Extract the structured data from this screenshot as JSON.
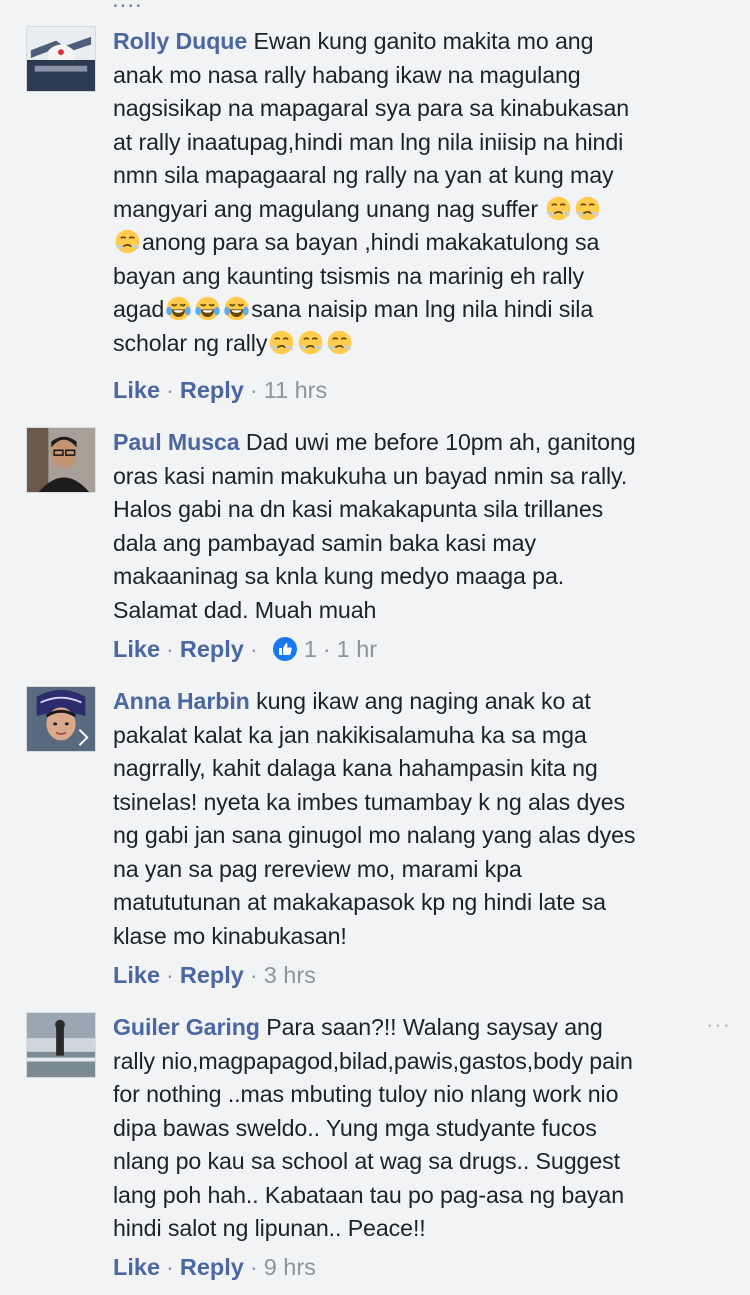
{
  "top_fragment": "....",
  "comments": [
    {
      "author": "Rolly Duque",
      "text_segments": [
        "Ewan kung ganito makita mo ang\nanak mo nasa rally habang ikaw na magulang\nnagsisikap na mapagaral sya para sa kinabukasan\nat rally inaatupag,hindi man lng nila iniisip na hindi\nnmn sila mapagaaral ng rally na yan at kung may\nmangyari ang magulang unang nag suffer ",
        "anong para sa bayan ,hindi makakatulong sa\nbayan ang kaunting tsismis na marinig eh rally\nagad",
        "sana naisip man lng nila hindi sila\nscholar ng rally"
      ],
      "emojis": [
        "steam-face",
        "steam-face",
        "steam-face",
        "tears-of-joy",
        "tears-of-joy",
        "tears-of-joy",
        "steam-face",
        "steam-face",
        "steam-face"
      ],
      "like_label": "Like",
      "reply_label": "Reply",
      "separator": "·",
      "time": "11 hrs"
    },
    {
      "author": "Paul Musca",
      "text": "Dad uwi me before 10pm ah, ganitong\noras kasi namin makukuha un bayad nmin sa rally.\nHalos gabi na dn kasi makakapunta sila trillanes\ndala ang pambayad samin baka kasi may\nmakaaninag sa knla kung medyo maaga pa.\nSalamat dad. Muah muah",
      "like_label": "Like",
      "reply_label": "Reply",
      "separator": "·",
      "reaction_icon": "like-thumb-icon",
      "reaction_count": "1",
      "time": "1 hr"
    },
    {
      "author": "Anna Harbin",
      "text": "kung ikaw ang naging anak ko at\npakalat kalat ka jan nakikisalamuha ka sa mga\nnagrrally, kahit dalaga kana hahampasin kita ng\ntsinelas! nyeta ka imbes tumambay k ng alas dyes\nng gabi jan sana ginugol mo nalang yang alas dyes\nna yan sa pag rereview mo, marami kpa\nmatututunan at makakapasok kp ng hindi late sa\nklase mo kinabukasan!",
      "like_label": "Like",
      "reply_label": "Reply",
      "separator": "·",
      "time": "3 hrs"
    },
    {
      "author": "Guiler Garing",
      "text": "Para saan?!! Walang saysay ang\nrally nio,magpapagod,bilad,pawis,gastos,body pain\nfor nothing ..mas mbuting tuloy nio nlang work nio\ndipa bawas sweldo.. Yung mga studyante fucos\nnlang po kau sa school at wag sa drugs.. Suggest\nlang poh hah.. Kabataan tau po pag-asa ng bayan\nhindi salot ng lipunan.. Peace!!",
      "like_label": "Like",
      "reply_label": "Reply",
      "separator": "·",
      "time": "9 hrs",
      "more_icon": "more-options-icon",
      "more_label": "···"
    }
  ],
  "colors": {
    "background": "#f2f3f5",
    "link": "#4b67a1",
    "text": "#1d2129",
    "meta": "#8d949e",
    "like_blue": "#1877f2"
  }
}
